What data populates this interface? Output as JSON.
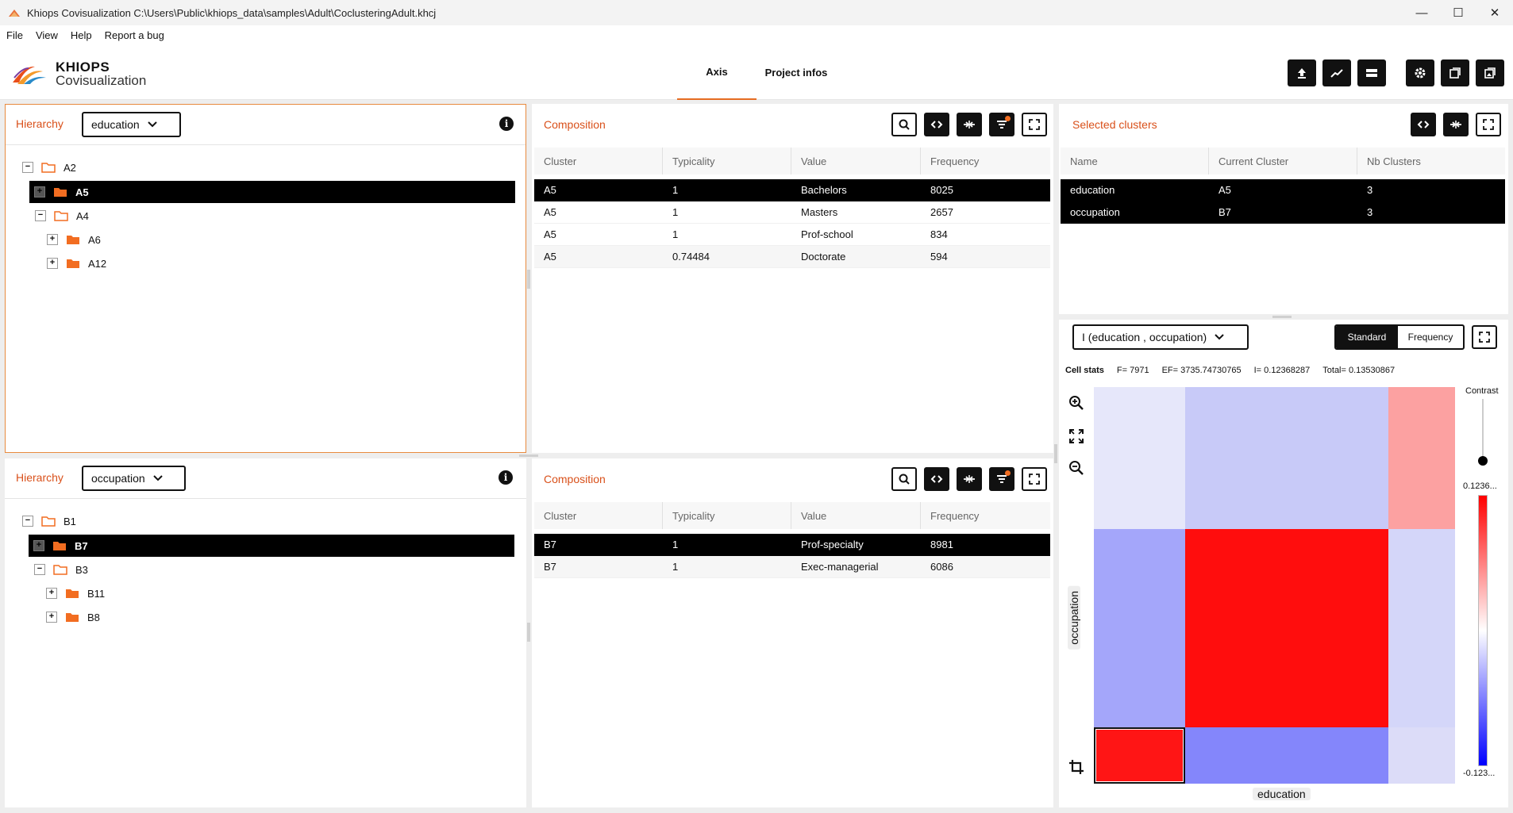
{
  "window": {
    "title": "Khiops Covisualization C:\\Users\\Public\\khiops_data\\samples\\Adult\\CoclusteringAdult.khcj",
    "controls": [
      "—",
      "☐",
      "✕"
    ]
  },
  "menu": [
    "File",
    "View",
    "Help",
    "Report a bug"
  ],
  "logo": {
    "line1": "KHIOPS",
    "line2": "Covisualization"
  },
  "tabs": [
    {
      "label": "Axis",
      "active": true
    },
    {
      "label": "Project infos",
      "active": false
    }
  ],
  "header_buttons": [
    "upload-icon",
    "chart-line-icon",
    "layout-icon",
    "gear-icon",
    "window-icon",
    "gallery-icon"
  ],
  "hierarchy_top": {
    "title": "Hierarchy",
    "select": "education",
    "info": "i",
    "tree": [
      {
        "label": "A2",
        "toggle": "−",
        "level": 0,
        "selected": false
      },
      {
        "label": "A5",
        "toggle": "+",
        "level": 1,
        "selected": true
      },
      {
        "label": "A4",
        "toggle": "−",
        "level": 1,
        "selected": false
      },
      {
        "label": "A6",
        "toggle": "+",
        "level": 2,
        "selected": false
      },
      {
        "label": "A12",
        "toggle": "+",
        "level": 2,
        "selected": false
      }
    ]
  },
  "hierarchy_bottom": {
    "title": "Hierarchy",
    "select": "occupation",
    "info": "i",
    "tree": [
      {
        "label": "B1",
        "toggle": "−",
        "level": 0,
        "selected": false
      },
      {
        "label": "B7",
        "toggle": "+",
        "level": 1,
        "selected": true
      },
      {
        "label": "B3",
        "toggle": "−",
        "level": 1,
        "selected": false
      },
      {
        "label": "B11",
        "toggle": "+",
        "level": 2,
        "selected": false
      },
      {
        "label": "B8",
        "toggle": "+",
        "level": 2,
        "selected": false
      }
    ]
  },
  "composition_top": {
    "title": "Composition",
    "columns": [
      "Cluster",
      "Typicality",
      "Value",
      "Frequency"
    ],
    "rows": [
      [
        "A5",
        "1",
        "Bachelors",
        "8025"
      ],
      [
        "A5",
        "1",
        "Masters",
        "2657"
      ],
      [
        "A5",
        "1",
        "Prof-school",
        "834"
      ],
      [
        "A5",
        "0.74484",
        "Doctorate",
        "594"
      ]
    ]
  },
  "composition_bottom": {
    "title": "Composition",
    "columns": [
      "Cluster",
      "Typicality",
      "Value",
      "Frequency"
    ],
    "rows": [
      [
        "B7",
        "1",
        "Prof-specialty",
        "8981"
      ],
      [
        "B7",
        "1",
        "Exec-managerial",
        "6086"
      ]
    ]
  },
  "selected_clusters": {
    "title": "Selected clusters",
    "columns": [
      "Name",
      "Current Cluster",
      "Nb Clusters"
    ],
    "rows": [
      [
        "education",
        "A5",
        "3"
      ],
      [
        "occupation",
        "B7",
        "3"
      ]
    ]
  },
  "matrix": {
    "select": "I (education , occupation)",
    "modes": [
      "Standard",
      "Frequency"
    ],
    "active_mode": "Standard",
    "cellstats": {
      "label": "Cell stats",
      "f": "F= 7971",
      "ef": "EF= 3735.74730765",
      "i": "I= 0.12368287",
      "total": "Total= 0.13530867"
    },
    "x_label": "education",
    "y_label": "occupation",
    "contrast_label": "Contrast",
    "legend_max": "0.1236...",
    "legend_min": "-0.123...",
    "col_fractions": [
      0.253,
      0.562,
      0.185
    ],
    "row_fractions": [
      0.358,
      0.5,
      0.142
    ],
    "cell_colors": [
      [
        "#e6e7fa",
        "#c8caf8",
        "#fca1a1"
      ],
      [
        "#a4a6fa",
        "#ff0d0d",
        "#d4d6f9"
      ],
      [
        "#ff1515",
        "#8486fb",
        "#dcdcf8"
      ]
    ],
    "selected_cell": [
      2,
      0
    ]
  }
}
